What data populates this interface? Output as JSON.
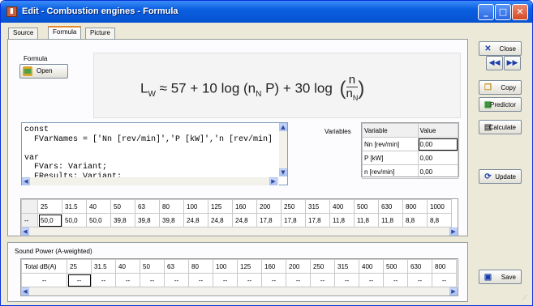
{
  "window": {
    "title": "Edit - Combustion engines - Formula"
  },
  "tabs": [
    {
      "label": "Source"
    },
    {
      "label": "Formula"
    },
    {
      "label": "Picture"
    }
  ],
  "formula": {
    "group_label": "Formula",
    "open_label": "Open",
    "expression_main": "L",
    "expression_sub": "W",
    "expression_mid": " ≈ 57 + 10 log (n",
    "expression_sub2": "N",
    "expression_tail": " P) + 30 log",
    "frac_num": "n",
    "frac_den": "n",
    "frac_den_sub": "N"
  },
  "code": {
    "text": "const\n  FVarNames = ['Nn [rev/min]','P [kW]','n [rev/min]\n\nvar\n  FVars: Variant;\n  FResults: Variant;"
  },
  "variables": {
    "label": "Variables",
    "headers": [
      "Variable",
      "Value"
    ],
    "rows": [
      {
        "name": "Nn [rev/min]",
        "value": "0,00"
      },
      {
        "name": "P [kW]",
        "value": "0,00"
      },
      {
        "name": "n [rev/min]",
        "value": "0,00"
      }
    ]
  },
  "spectrum": {
    "frequencies": [
      "25",
      "31.5",
      "40",
      "50",
      "63",
      "80",
      "100",
      "125",
      "160",
      "200",
      "250",
      "315",
      "400",
      "500",
      "630",
      "800",
      "1000"
    ],
    "row_label": "--",
    "values": [
      "50,0",
      "50,0",
      "50,0",
      "39,8",
      "39,8",
      "39,8",
      "24,8",
      "24,8",
      "24,8",
      "17,8",
      "17,8",
      "17,8",
      "11,8",
      "11,8",
      "11,8",
      "8,8",
      "8,8"
    ]
  },
  "sound_power": {
    "title": "Sound Power (A-weighted)",
    "headers": [
      "Total dB(A)",
      "25",
      "31.5",
      "40",
      "50",
      "63",
      "80",
      "100",
      "125",
      "160",
      "200",
      "250",
      "315",
      "400",
      "500",
      "630",
      "800"
    ],
    "values": [
      "--",
      "--",
      "--",
      "--",
      "--",
      "--",
      "--",
      "--",
      "--",
      "--",
      "--",
      "--",
      "--",
      "--",
      "--",
      "--",
      "--"
    ]
  },
  "buttons": {
    "close": "Close",
    "copy": "Copy",
    "predictor": "Predictor",
    "calculate": "Calculate",
    "update": "Update",
    "save": "Save",
    "prev": "◀◀",
    "next": "▶▶"
  }
}
